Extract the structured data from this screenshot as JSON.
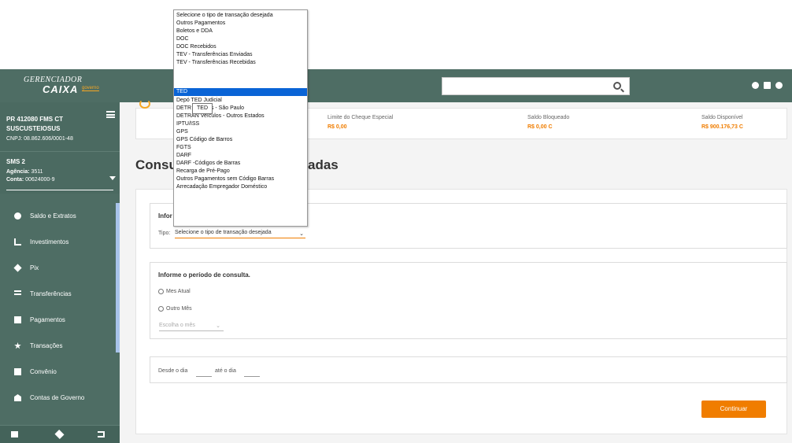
{
  "header": {
    "logo_line1": "GERENCIADOR",
    "logo_line2": "CAIXA",
    "logo_tag": "governo",
    "search_placeholder": "",
    "icons": [
      "help-icon",
      "calendar-icon",
      "gear-icon"
    ]
  },
  "sidebar": {
    "account_name_1": "PR 412080 FMS CT",
    "account_name_2": "SUSCUSTEIOSUS",
    "cnpj": "CNPJ: 08.862.606/0001-48",
    "unit": "SMS 2",
    "agencia_label": "Agência:",
    "agencia": "3511",
    "conta_label": "Conta:",
    "conta": "00624000-9",
    "items": [
      {
        "label": "Saldo e Extratos",
        "icon": "coin-icon"
      },
      {
        "label": "Investimentos",
        "icon": "chart-icon"
      },
      {
        "label": "Pix",
        "icon": "pix-icon"
      },
      {
        "label": "Transferências",
        "icon": "transfer-icon"
      },
      {
        "label": "Pagamentos",
        "icon": "barcode-icon"
      },
      {
        "label": "Transações",
        "icon": "star-icon"
      },
      {
        "label": "Convênio",
        "icon": "document-icon"
      },
      {
        "label": "Contas de Governo",
        "icon": "government-icon"
      }
    ],
    "footer_icons": [
      "mail-icon",
      "expand-icon",
      "logout-icon"
    ]
  },
  "balances": [
    {
      "label": "Limite do Cheque Especial",
      "value": "R$ 0,00"
    },
    {
      "label": "Saldo Bloqueado",
      "value": "R$ 0,00 C"
    },
    {
      "label": "Saldo Disponível",
      "value": "R$ 900.176,73 C"
    }
  ],
  "page": {
    "title_left": "Consu",
    "title_right": "adas",
    "info_box_title": "Infor",
    "tipo_label": "Tipo:",
    "tipo_value": "Selecione o tipo de transação desejada",
    "period_title": "Informe o período de consulta.",
    "radio_current": "Mes Atual",
    "radio_other": "Outro Mês",
    "month_placeholder": "Escolha o mês",
    "desde_label": "Desde o dia",
    "ate_label": "até o dia",
    "continue_button": "Continuar"
  },
  "dropdown": {
    "options": [
      "Selecione o tipo de transação desejada",
      "Outros Pagamentos",
      "Boletos e DDA",
      "DOC",
      "DOC Recebidos",
      "TEV - Transferências Enviadas",
      "TEV - Transferências Recebidas",
      "TED",
      "Depó      TED Judicial",
      "DETR      Veículos - São Paulo",
      "DETRAN Veículos - Outros Estados",
      "IPTU/ISS",
      "GPS",
      "GPS Código de Barros",
      "FGTS",
      "DARF",
      "DARF -Códigos de Barras",
      "Recarga de Pré-Pago",
      "Outros Pagamentos sem Código Barras",
      "Arrecadação Empregador Doméstico"
    ],
    "selected_index": 7,
    "tooltip": "TED"
  }
}
